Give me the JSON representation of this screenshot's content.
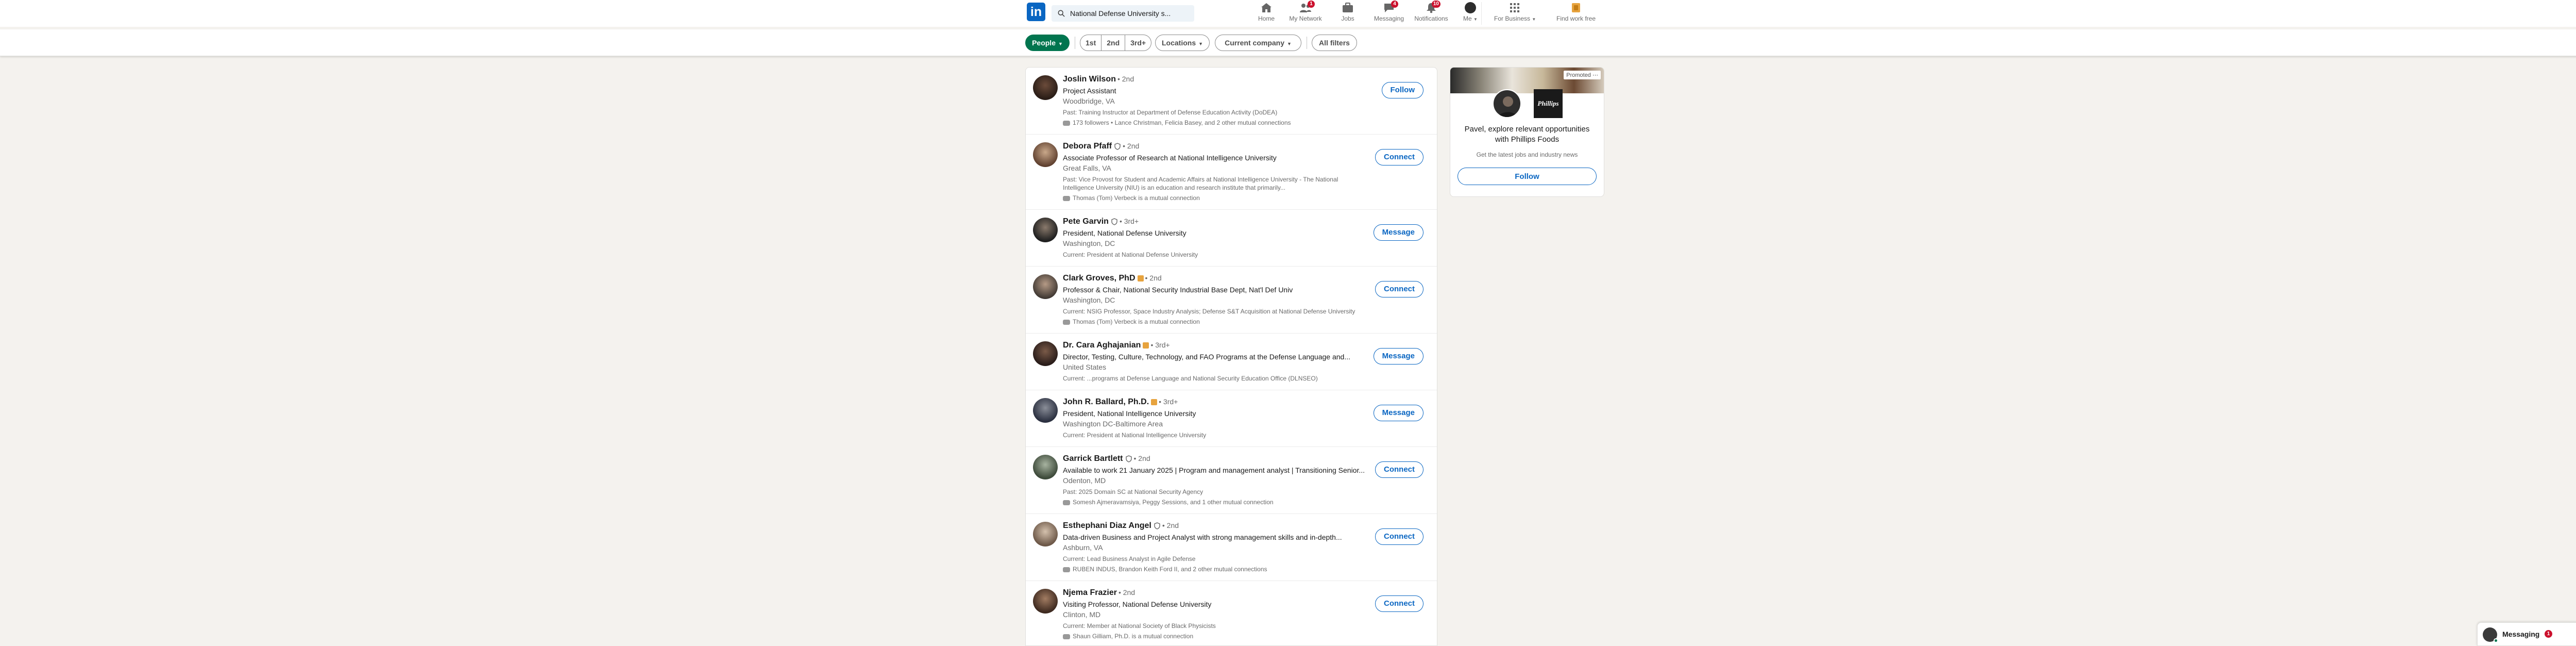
{
  "nav": {
    "search_value": "National Defense University s...",
    "items": [
      {
        "label": "Home",
        "icon": "home-icon",
        "badge": ""
      },
      {
        "label": "My Network",
        "icon": "network-icon",
        "badge": "1"
      },
      {
        "label": "Jobs",
        "icon": "jobs-icon",
        "badge": ""
      },
      {
        "label": "Messaging",
        "icon": "messaging-icon",
        "badge": "4"
      },
      {
        "label": "Notifications",
        "icon": "bell-icon",
        "badge": "10"
      },
      {
        "label": "Me",
        "icon": "me-avatar",
        "badge": ""
      },
      {
        "label": "For Business",
        "icon": "grid-icon",
        "badge": ""
      },
      {
        "label": "Find work free",
        "icon": "premium-icon",
        "badge": ""
      }
    ]
  },
  "filters": {
    "people": "People",
    "degree_1": "1st",
    "degree_2": "2nd",
    "degree_3": "3rd+",
    "locations": "Locations",
    "current_company": "Current company",
    "all_filters": "All filters"
  },
  "results": [
    {
      "name": "Joslin Wilson",
      "degree": "• 2nd",
      "verified": false,
      "premium": false,
      "headline": "Project Assistant",
      "location": "Woodbridge, VA",
      "summary": "Past: Training Instructor at Department of Defense Education Activity (DoDEA)",
      "mutual": "173 followers • Lance Christman, Felicia Basey, and 2 other mutual connections",
      "action": "Follow"
    },
    {
      "name": "Debora Pfaff",
      "degree": "• 2nd",
      "verified": true,
      "premium": false,
      "headline": "Associate Professor of Research at National Intelligence University",
      "location": "Great Falls, VA",
      "summary": "Past: Vice Provost for Student and Academic Affairs at National Intelligence University - The National Intelligence University (NIU) is an education and research institute that primarily...",
      "mutual": "Thomas (Tom) Verbeck is a mutual connection",
      "action": "Connect"
    },
    {
      "name": "Pete Garvin",
      "degree": "• 3rd+",
      "verified": true,
      "premium": false,
      "headline": "President, National Defense University",
      "location": "Washington, DC",
      "summary": "Current: President at National Defense University",
      "mutual": "",
      "action": "Message"
    },
    {
      "name": "Clark Groves, PhD",
      "degree": "• 2nd",
      "verified": false,
      "premium": true,
      "headline": "Professor & Chair, National Security Industrial Base Dept, Nat'l Def Univ",
      "location": "Washington, DC",
      "summary": "Current: NSIG Professor, Space Industry Analysis; Defense S&T Acquisition at National Defense University",
      "mutual": "Thomas (Tom) Verbeck is a mutual connection",
      "action": "Connect"
    },
    {
      "name": "Dr. Cara Aghajanian",
      "degree": "• 3rd+",
      "verified": false,
      "premium": true,
      "headline": "Director, Testing, Culture, Technology, and FAO Programs at the Defense Language and...",
      "location": "United States",
      "summary": "Current: ...programs at Defense Language and National Security Education Office (DLNSEO)",
      "mutual": "",
      "action": "Message"
    },
    {
      "name": "John R. Ballard, Ph.D.",
      "degree": "• 3rd+",
      "verified": false,
      "premium": true,
      "headline": "President, National Intelligence University",
      "location": "Washington DC-Baltimore Area",
      "summary": "Current: President at National Intelligence University",
      "mutual": "",
      "action": "Message"
    },
    {
      "name": "Garrick Bartlett",
      "degree": "• 2nd",
      "verified": true,
      "premium": false,
      "headline": "Available to work 21 January 2025 | Program and management analyst | Transitioning Senior...",
      "location": "Odenton, MD",
      "summary": "Past: 2025 Domain SC at National Security Agency",
      "mutual": "Somesh Ajmeravamsiya, Peggy Sessions, and 1 other mutual connection",
      "action": "Connect"
    },
    {
      "name": "Esthephani Diaz Angel",
      "degree": "• 2nd",
      "verified": true,
      "premium": false,
      "headline": "Data-driven Business and Project Analyst with strong management skills and in-depth...",
      "location": "Ashburn, VA",
      "summary": "Current: Lead Business Analyst in Agile Defense",
      "mutual": "RUBEN INDUS, Brandon Keith Ford II, and 2 other mutual connections",
      "action": "Connect"
    },
    {
      "name": "Njema Frazier",
      "degree": "• 2nd",
      "verified": false,
      "premium": false,
      "headline": "Visiting Professor, National Defense University",
      "location": "Clinton, MD",
      "summary": "Current: Member at National Society of Black Physicists",
      "mutual": "Shaun Gilliam, Ph.D. is a mutual connection",
      "action": "Connect"
    }
  ],
  "ad": {
    "promoted": "Promoted",
    "brand": "Phillips",
    "text": "Pavel, explore relevant opportunities with Phillips Foods",
    "sub": "Get the latest jobs and industry news",
    "button": "Follow"
  },
  "messaging": {
    "label": "Messaging",
    "badge": "1"
  },
  "colors": {
    "brand": "#0a66c2",
    "accent_green": "#01754f",
    "badge_red": "#cb112d"
  }
}
